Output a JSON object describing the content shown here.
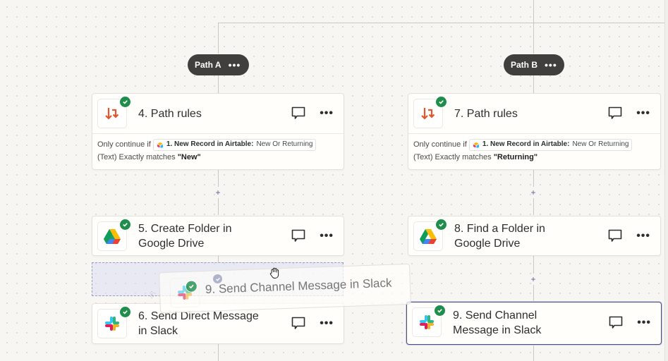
{
  "paths": [
    {
      "label": "Path A",
      "menu_icon": "more-horizontal-icon",
      "steps": [
        {
          "number": "4.",
          "title": "4. Path rules",
          "app": "path-rules",
          "status": "complete",
          "rule": {
            "prefix": "Only continue if",
            "field_step": "1. New Record in Airtable:",
            "field_name": "New Or Returning",
            "suffix": "(Text) Exactly matches",
            "value": "\"New\""
          }
        },
        {
          "title_line1": "5. Create Folder in",
          "title_line2": "Google Drive",
          "app": "google-drive",
          "status": "complete"
        },
        {
          "title_line1": "6. Send Direct Message",
          "title_line2": "in Slack",
          "app": "slack",
          "status": "complete"
        }
      ]
    },
    {
      "label": "Path B",
      "menu_icon": "more-horizontal-icon",
      "steps": [
        {
          "title": "7. Path rules",
          "app": "path-rules",
          "status": "complete",
          "rule": {
            "prefix": "Only continue if",
            "field_step": "1. New Record in Airtable:",
            "field_name": "New Or Returning",
            "suffix": "(Text) Exactly matches",
            "value": "\"Returning\""
          }
        },
        {
          "title_line1": "8. Find a Folder in",
          "title_line2": "Google Drive",
          "app": "google-drive",
          "status": "complete"
        },
        {
          "title_line1": "9. Send Channel",
          "title_line2": "Message in Slack",
          "app": "slack",
          "status": "complete",
          "selected": true
        }
      ]
    }
  ],
  "dragging": {
    "title": "9. Send Channel Message in Slack",
    "app": "slack"
  },
  "pill_more_label": "•••",
  "card_more_label": "•••",
  "add_step_label": "+",
  "colors": {
    "accent": "#4a4f87",
    "success": "#1e8e4a",
    "path_icon": "#e8542a",
    "pill_bg": "#403f3e"
  }
}
